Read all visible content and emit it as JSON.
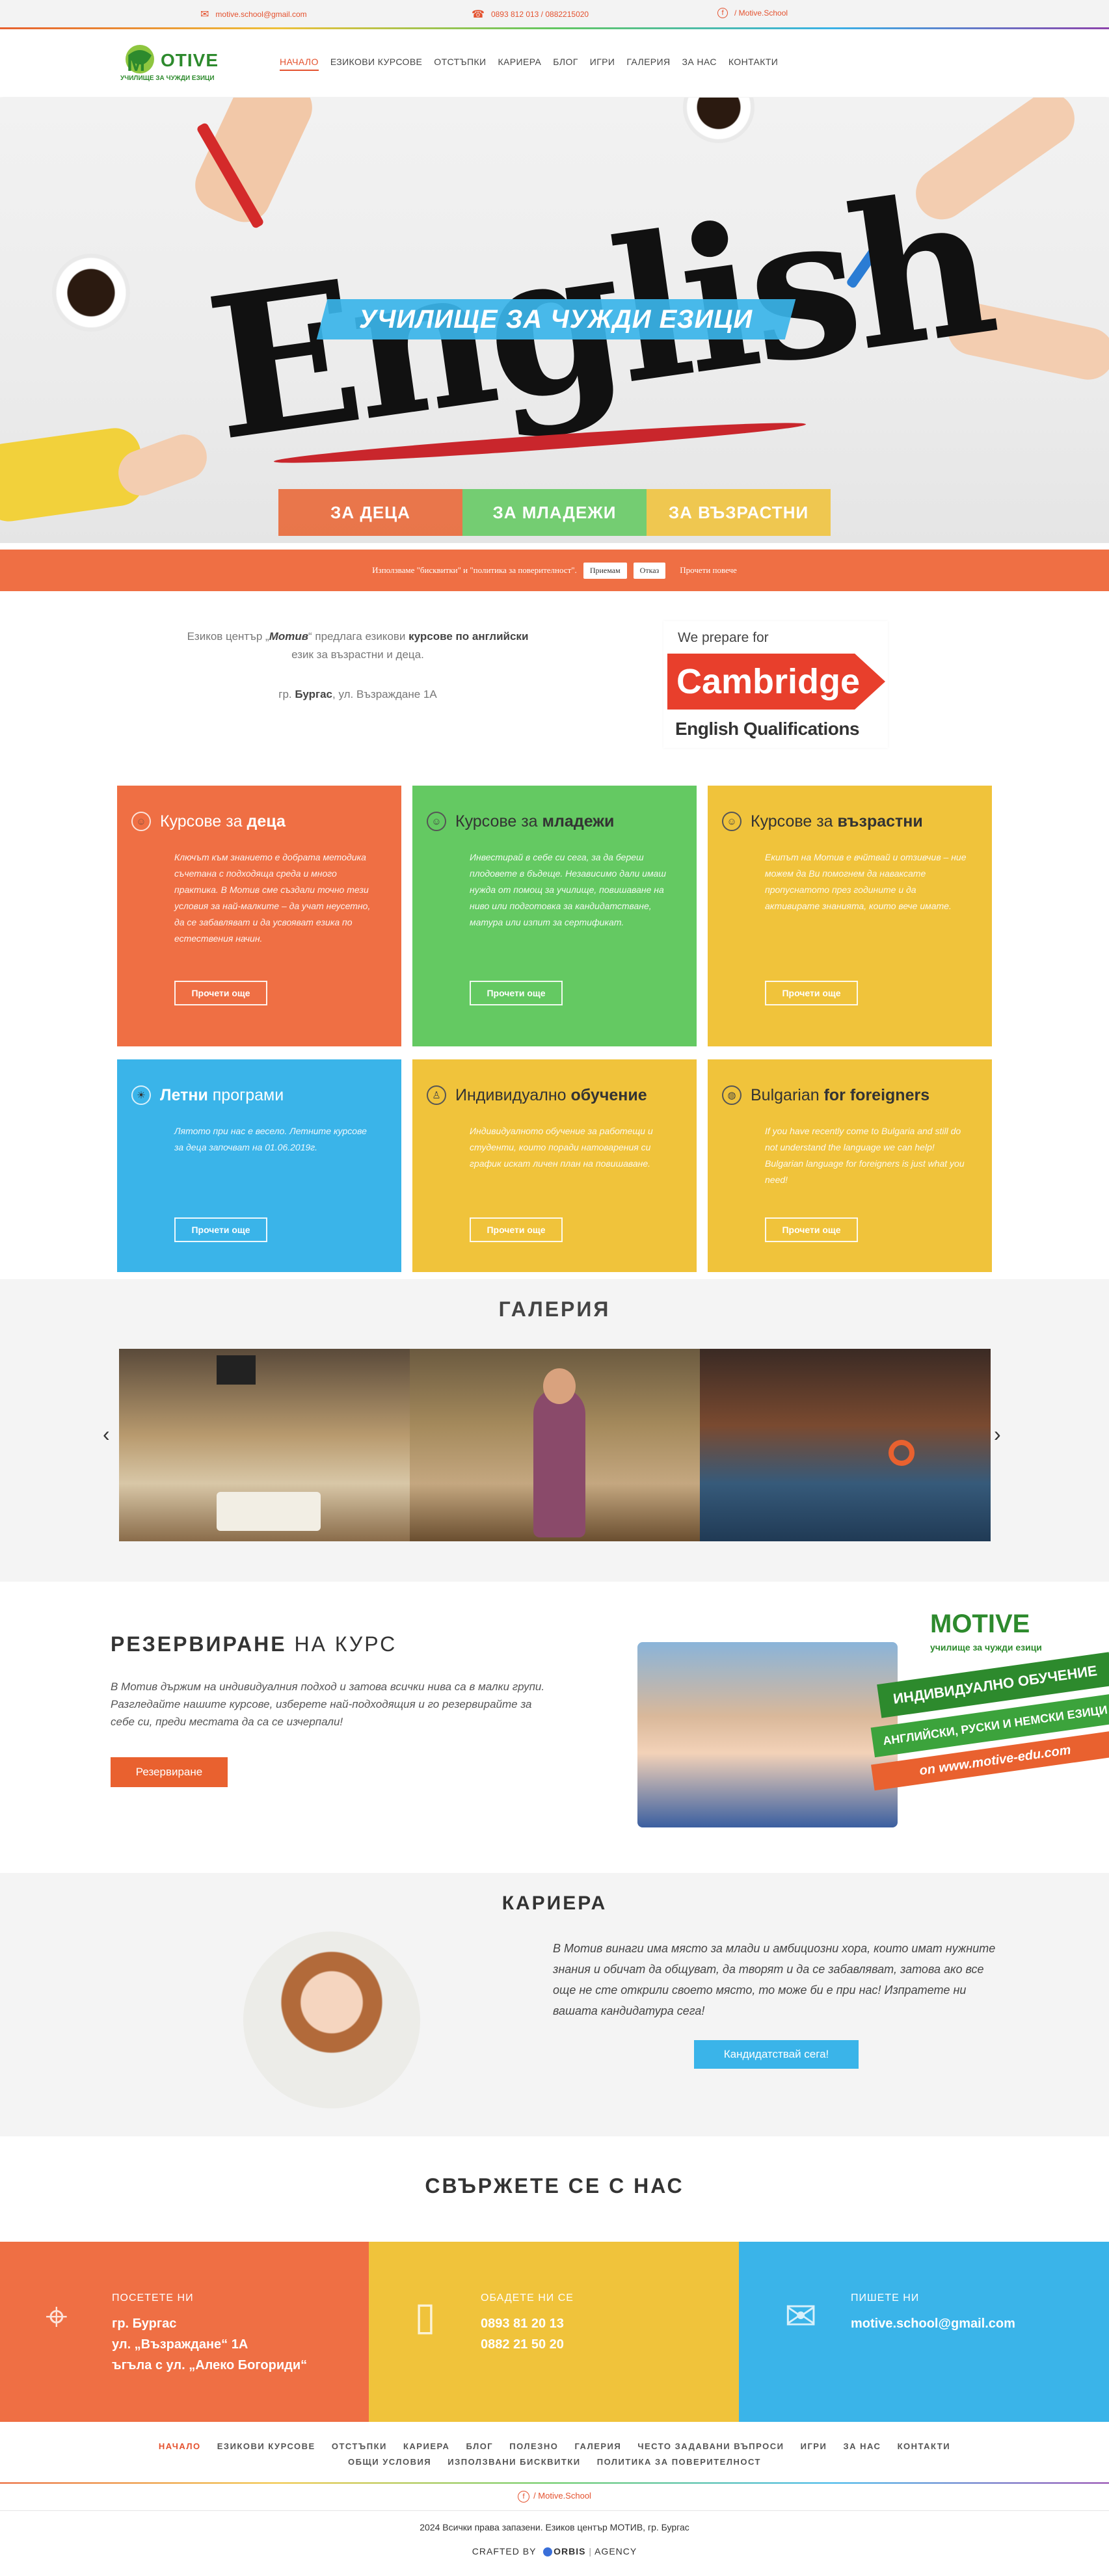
{
  "topbar": {
    "email": "motive.school@gmail.com",
    "phone": "0893 812 013 / 0882215020",
    "facebook": "/ Motive.School"
  },
  "logo": {
    "word": "OTIVE",
    "letter": "M",
    "tagline": "УЧИЛИЩЕ ЗА ЧУЖДИ ЕЗИЦИ"
  },
  "nav": [
    "НАЧАЛО",
    "ЕЗИКОВИ КУРСОВЕ",
    "ОТСТЪПКИ",
    "КАРИЕРА",
    "БЛОГ",
    "ИГРИ",
    "ГАЛЕРИЯ",
    "ЗА НАС",
    "КОНТАКТИ"
  ],
  "hero": {
    "big_word": "English",
    "banner": "УЧИЛИЩЕ ЗА ЧУЖДИ ЕЗИЦИ",
    "tabs": [
      "ЗА ДЕЦА",
      "ЗА МЛАДЕЖИ",
      "ЗА ВЪЗРАСТНИ"
    ]
  },
  "cookie": {
    "text": "Използваме \"бисквитки\" и \"политика за поверителност\".",
    "accept": "Приемам",
    "reject": "Отказ",
    "more": "Прочети повече"
  },
  "intro": {
    "part1": "Езиков център „",
    "brand": "Мотив",
    "part2": "“ предлага езикови ",
    "bold1": "курсове по английски",
    "part3": " език за възрастни и деца.",
    "city": "гр. ",
    "city_bold": "Бургас",
    "street": ", ул. Възраждане 1А"
  },
  "cambridge": {
    "prepare": "We prepare for",
    "name": "Cambridge",
    "qual": "English Qualifications"
  },
  "courses": [
    {
      "light": "Курсове за ",
      "bold": "деца",
      "icon": "children-icon",
      "text": "Ключът към знанието е добрата методика съчетана с подходяща среда и много практика. В Мотив сме създали точно тези условия за най-малките – да учат неусетно, да се забавляват и да усвояват езика по естествения начин.",
      "button": "Прочети още"
    },
    {
      "light": "Курсове за ",
      "bold": "младежи",
      "icon": "youth-icon",
      "text": "Инвестирай в себе си сега, за да береш плодовете в бъдеще. Независимо дали имаш нужда от помощ за училище, повишаване на ниво или подготовка за кандидатстване, матура или изпит за сертификат.",
      "button": "Прочети още"
    },
    {
      "light": "Курсове за ",
      "bold": "възрастни",
      "icon": "adults-icon",
      "text": "Екипът на Мотив е вчйтвай и отзивчив – ние можем да Ви помогнем да наваксате пропуснатото през годините и да активирате знанията, които вече имате.",
      "button": "Прочети още"
    },
    {
      "light": "",
      "bold": "Летни",
      "light2": " програми",
      "icon": "sun-icon",
      "text": "Лятото при нас е весело. Летните курсове за деца започват на 01.06.2019г.",
      "button": "Прочети още"
    },
    {
      "light": "Индивидуално ",
      "bold": "обучение",
      "icon": "teacher-icon",
      "text": "Индивидуалното обучение за работещи и студенти, които поради натоварения си график искат личен план на повишаване.",
      "button": "Прочети още"
    },
    {
      "light": "Bulgarian ",
      "bold": "for foreigners",
      "icon": "globe-icon",
      "text": "If you have recently come to Bulgaria and still do not understand the language we can help! Bulgarian language for foreigners is just what you need!",
      "button": "Прочети още"
    }
  ],
  "gallery": {
    "title": "ГАЛЕРИЯ"
  },
  "reservation": {
    "title_bold": "РЕЗЕРВИРАНЕ",
    "title_light": " НА КУРС",
    "text": "В Мотив държим на индивидуалния подход и затова всички нива са в малки групи. Разгледайте нашите курсове, изберете най-подходящия и го резервирайте за себе си, преди местата да са се изчерпали!",
    "button": "Резервиране",
    "promo_logo": "MOTIVE",
    "promo_tag": "училище за чужди езици",
    "promo_line1": "ИНДИВИДУАЛНО ОБУЧЕНИЕ",
    "promo_line2": "АНГЛИЙСКИ, РУСКИ И НЕМСКИ ЕЗИЦИ",
    "promo_line3": "on www.motive-edu.com"
  },
  "career": {
    "title": "КАРИЕРА",
    "text": "В Мотив винаги има място за млади и амбициозни хора, които имат нужните знания и обичат да общуват, да творят и да се забавляват, затова ако все още не сте открили своето място, то може би е при нас! Изпратете ни вашата кандидатура сега!",
    "button": "Кандидатствай сега!"
  },
  "contact": {
    "title": "СВЪРЖЕТЕ СЕ С НАС",
    "visit_label": "ПОСЕТЕТЕ НИ",
    "visit_lines": [
      "гр. Бургас",
      "ул. „Възраждане“ 1А",
      "ъгъла с ул. „Алеко Богориди“"
    ],
    "call_label": "ОБАДЕТЕ НИ СЕ",
    "call_lines": [
      "0893 81 20 13",
      "0882 21 50 20"
    ],
    "write_label": "ПИШЕТЕ НИ",
    "write_lines": [
      "motive.school@gmail.com"
    ]
  },
  "footer": {
    "nav_row1": [
      "НАЧАЛО",
      "ЕЗИКОВИ КУРСОВЕ",
      "ОТСТЪПКИ",
      "КАРИЕРА",
      "БЛОГ",
      "ПОЛЕЗНО",
      "ГАЛЕРИЯ",
      "ЧЕСТО ЗАДАВАНИ ВЪПРОСИ",
      "ИГРИ",
      "ЗА НАС",
      "КОНТАКТИ"
    ],
    "nav_row2": [
      "ОБЩИ УСЛОВИЯ",
      "ИЗПОЛЗВАНИ БИСКВИТКИ",
      "ПОЛИТИКА ЗА ПОВЕРИТЕЛНОСТ"
    ],
    "facebook": "/ Motive.School",
    "copyright": "2024 Всички права запазени. Езиков център МОТИВ, гр. Бургас",
    "crafted": "CRAFTED BY",
    "agency_a": "ORBIS",
    "agency_b": "AGENCY"
  },
  "colors": {
    "orange": "#ef6f44",
    "green": "#64c962",
    "yellow": "#f0c33b",
    "blue": "#3ab4e9",
    "coral_red": "#e9612f"
  }
}
